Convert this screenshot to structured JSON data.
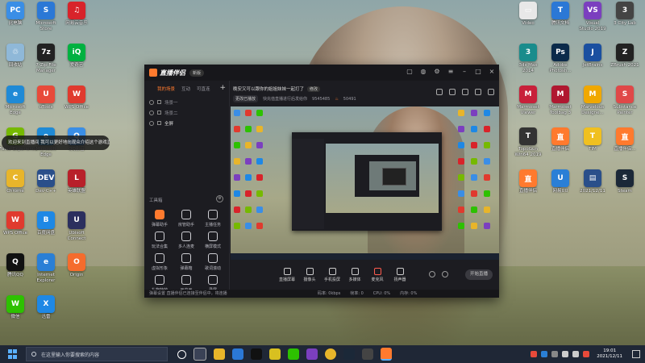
{
  "desktop": {
    "icons_left": [
      {
        "label": "此电脑",
        "glyph": "PC",
        "color": "#3a8ee6"
      },
      {
        "label": "Microsoft\nStore",
        "glyph": "S",
        "color": "#2b78d6"
      },
      {
        "label": "网易云音乐",
        "glyph": "♫",
        "color": "#d8232a"
      },
      {
        "label": "回收站",
        "glyph": "♲",
        "color": "#8fb8d8"
      },
      {
        "label": "7-Zip File\nManager",
        "glyph": "7z",
        "color": "#222222"
      },
      {
        "label": "爱奇艺",
        "glyph": "iQ",
        "color": "#00b140"
      },
      {
        "label": "Microsoft\nEdge",
        "glyph": "e",
        "color": "#1f8ad6"
      },
      {
        "label": "uTools",
        "glyph": "U",
        "color": "#e84a3a"
      },
      {
        "label": "WPS Office",
        "glyph": "W",
        "color": "#e03a2e"
      },
      {
        "label": "GeForce Experience",
        "glyph": "G",
        "color": "#76b900"
      },
      {
        "label": "Microsoft\nEdge",
        "glyph": "e",
        "color": "#1f8ad6"
      },
      {
        "label": "QQ影音",
        "glyph": "Q",
        "color": "#3a8ee6"
      },
      {
        "label": "Chrome",
        "glyph": "C",
        "color": "#e8b52a"
      },
      {
        "label": "Dev-C++",
        "glyph": "DEV",
        "color": "#2a4f8a"
      },
      {
        "label": "英雄联盟",
        "glyph": "L",
        "color": "#b8202a"
      },
      {
        "label": "WPS Office",
        "glyph": "W",
        "color": "#e03a2e"
      },
      {
        "label": "百度网盘",
        "glyph": "B",
        "color": "#1e88e5"
      },
      {
        "label": "Ubisoft\nConnect",
        "glyph": "U",
        "color": "#2b2f5e"
      },
      {
        "label": "腾讯QQ",
        "glyph": "Q",
        "color": "#111111"
      },
      {
        "label": "Internet\nExplorer",
        "glyph": "e",
        "color": "#2a7fd6"
      },
      {
        "label": "Origin",
        "glyph": "O",
        "color": "#f56c2d"
      },
      {
        "label": "微信",
        "glyph": "W",
        "color": "#2dc100"
      },
      {
        "label": "迅雷",
        "glyph": "X",
        "color": "#1e88e5"
      }
    ],
    "icons_right": [
      {
        "label": "Video",
        "glyph": "▭",
        "color": "#e8e8e8"
      },
      {
        "label": "腾讯文档",
        "glyph": "T",
        "color": "#2b78d6"
      },
      {
        "label": "Visual\nStudio 2019",
        "glyph": "VS",
        "color": "#7b3fbf"
      },
      {
        "label": "3 City Lab",
        "glyph": "3",
        "color": "#444444"
      },
      {
        "label": "3ds Max\n2014",
        "glyph": "3",
        "color": "#1a8c8c"
      },
      {
        "label": "Adobe\nPhotosh...",
        "glyph": "Ps",
        "color": "#0b2a4a"
      },
      {
        "label": "JetBrains",
        "glyph": "J",
        "color": "#1a4fa0"
      },
      {
        "label": "ZBrush 2021",
        "glyph": "Z",
        "color": "#222222"
      },
      {
        "label": "Marmoset\nViewer",
        "glyph": "M",
        "color": "#c8203a"
      },
      {
        "label": "Marmoset\nToolbag 3",
        "glyph": "M",
        "color": "#b01830"
      },
      {
        "label": "Marvelous\nDesigne...",
        "glyph": "M",
        "color": "#f0a800"
      },
      {
        "label": "Substance\nPainter",
        "glyph": "S",
        "color": "#e04848"
      },
      {
        "label": "TopoGun\nWin64 2019",
        "glyph": "T",
        "color": "#333333"
      },
      {
        "label": "直播伴侣",
        "glyph": "直",
        "color": "#ff7a2e"
      },
      {
        "label": "TIM",
        "glyph": "T",
        "color": "#f0c020"
      },
      {
        "label": "直播伴侣...",
        "glyph": "直",
        "color": "#ff7a2e"
      },
      {
        "label": "直播伴侣",
        "glyph": "直",
        "color": "#ff7a2e"
      },
      {
        "label": "网易UU",
        "glyph": "U",
        "color": "#2a7fd6"
      },
      {
        "label": "2021/12/11",
        "glyph": "▤",
        "color": "#2a4f8a"
      },
      {
        "label": "Steam",
        "glyph": "S",
        "color": "#1b2838"
      }
    ],
    "notification": "欢迎来到直播间 我可以更好地向观众介绍这个游戏直播啊"
  },
  "app": {
    "title": "直播伴侣",
    "version": "新版",
    "sidebar_tabs": [
      "我的场景",
      "互动",
      "可直连",
      "+"
    ],
    "scenes": [
      "场景一",
      "场景二",
      "全屏"
    ],
    "tools_title": "工具箱",
    "tools": [
      "弹幕助手",
      "房管助手",
      "主播任务",
      "玩法合集",
      "多人连麦",
      "横屏模式",
      "虚拟形象",
      "弹幕箱",
      "歌词滚动",
      "礼物特效",
      "画中画",
      "录屏"
    ],
    "room_title": "晚安又可以跟你的姐姐妹妹一起打了",
    "modify": "修改",
    "room_info": [
      "更改已播放",
      "快充值直播进行后发给你",
      "9545485",
      "50491"
    ],
    "bottom_buttons": [
      "直播屏幕",
      "摄像头",
      "手机投屏",
      "多媒体",
      "麦克风",
      "扬声器"
    ],
    "start_live": "开始直播",
    "status_text": "弹幕设置  直播伴侣已连接至伴侣中，将连播",
    "stats": [
      "码率: 0kbps",
      "帧率: 0",
      "CPU: 0%",
      "内存: 0%"
    ]
  },
  "taskbar": {
    "search_placeholder": "在这里输入你要搜索的内容",
    "time": "19:01",
    "date": "2021/12/11"
  }
}
